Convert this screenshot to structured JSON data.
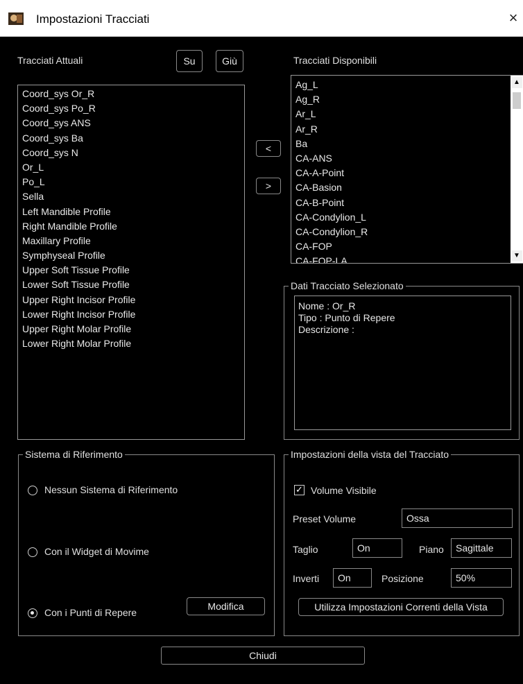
{
  "window": {
    "title": "Impostazioni Tracciati",
    "close_icon": "×"
  },
  "current": {
    "label": "Tracciati Attuali",
    "up_label": "Su",
    "down_label": "Giù",
    "items": [
      "Coord_sys Or_R",
      "Coord_sys Po_R",
      "Coord_sys ANS",
      "Coord_sys Ba",
      "Coord_sys N",
      "Or_L",
      "Po_L",
      "Sella",
      "Left Mandible Profile",
      "Right Mandible Profile",
      "Maxillary Profile",
      "Symphyseal Profile",
      "Upper Soft Tissue Profile",
      "Lower Soft Tissue Profile",
      "Upper Right Incisor Profile",
      "Lower Right Incisor Profile",
      "Upper Right Molar Profile",
      "Lower Right Molar Profile"
    ]
  },
  "move": {
    "left_label": "<",
    "right_label": ">"
  },
  "available": {
    "label": "Tracciati Disponibili",
    "items": [
      "Ag_L",
      "Ag_R",
      "Ar_L",
      "Ar_R",
      "Ba",
      "CA-ANS",
      "CA-A-Point",
      "CA-Basion",
      "CA-B-Point",
      "CA-Condylion_L",
      "CA-Condylion_R",
      "CA-FOP",
      "CA-FOP-LA"
    ]
  },
  "selected": {
    "title": "Dati Tracciato Selezionato",
    "name_line": "Nome : Or_R",
    "type_line": "Tipo : Punto di Repere",
    "desc_line": "Descrizione :"
  },
  "reference": {
    "title": "Sistema di Riferimento",
    "options": [
      "Nessun Sistema di Riferimento",
      "Con il Widget di Movime",
      "Con i Punti di Repere"
    ],
    "selected_index": 2,
    "modify_label": "Modifica"
  },
  "view": {
    "title": "Impostazioni della vista del Tracciato",
    "volume_visible_label": "Volume Visibile",
    "volume_visible_checked": true,
    "preset_label": "Preset Volume",
    "preset_value": "Ossa",
    "cut_label": "Taglio",
    "cut_value": "On",
    "plane_label": "Piano",
    "plane_value": "Sagittale",
    "invert_label": "Inverti",
    "invert_value": "On",
    "position_label": "Posizione",
    "position_value": "50%",
    "use_current_label": "Utilizza Impostazioni Correnti della Vista"
  },
  "footer": {
    "close_label": "Chiudi"
  }
}
